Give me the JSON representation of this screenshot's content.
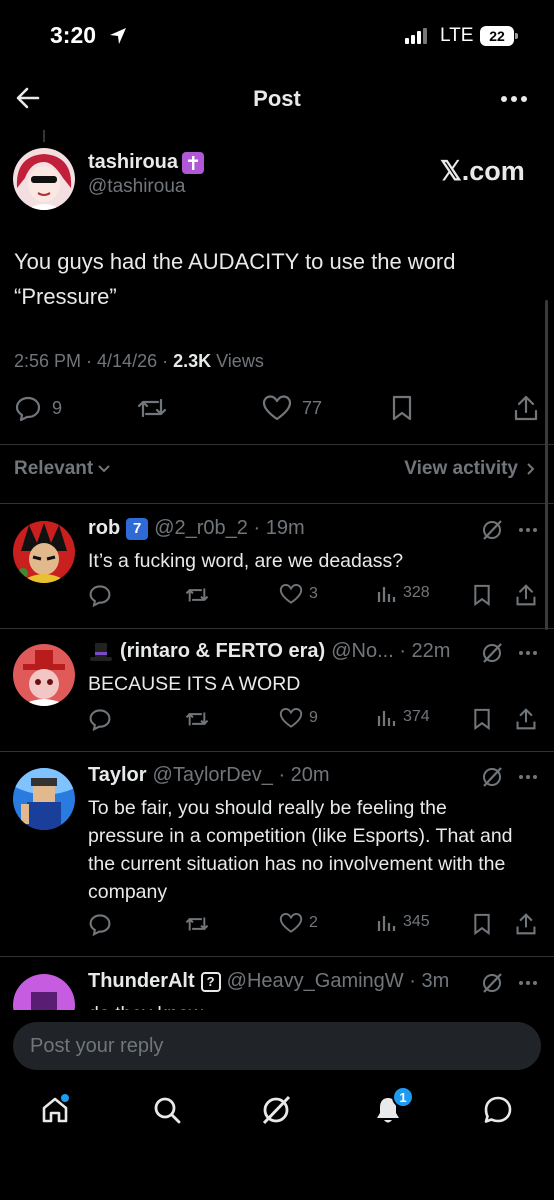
{
  "status_bar": {
    "time": "3:20",
    "network": "LTE",
    "battery": "22"
  },
  "header": {
    "title": "Post"
  },
  "post": {
    "author_name": "tashiroua",
    "author_handle": "@tashiroua",
    "source_label": "𝕏.com",
    "text": "You guys had the AUDACITY to use the word “Pressure”",
    "time": "2:56 PM · 4/14/26 · ",
    "views_count": "2.3K",
    "views_label": " Views",
    "replies": "9",
    "likes": "77"
  },
  "filter": {
    "sort_label": "Relevant",
    "activity_label": "View activity"
  },
  "replies": [
    {
      "name": "rob",
      "badge": "7",
      "handle_time": "@2_r0b_2 · 19m",
      "text": "It’s a fucking word, are we deadass?",
      "likes": "3",
      "views": "328"
    },
    {
      "name": "(rintaro & FERTO era)",
      "handle_time": "@No... · 22m",
      "text": "BECAUSE ITS A WORD",
      "likes": "9",
      "views": "374"
    },
    {
      "name": "Taylor",
      "handle_time": "@TaylorDev_ · 20m",
      "text": "To be fair, you should really be feeling the pressure in a competition (like Esports). That and the current situation has no involvement with the company",
      "likes": "2",
      "views": "345"
    },
    {
      "name": "ThunderAlt",
      "badge": "?",
      "handle_time": "@Heavy_GamingW · 3m",
      "text": "do they know"
    }
  ],
  "reply_input": {
    "placeholder": "Post your reply"
  },
  "tabbar": {
    "notification_count": "1"
  },
  "colors": {
    "accent": "#1d9bf0",
    "background": "#000000",
    "muted": "#71767b",
    "divider": "#2f3336"
  },
  "icons": [
    "location-arrow-icon",
    "back-arrow-icon",
    "more-icon",
    "reply-icon",
    "repost-icon",
    "like-icon",
    "bookmark-icon",
    "share-icon",
    "views-icon",
    "grok-icon",
    "home-icon",
    "search-icon",
    "notifications-icon",
    "messages-icon"
  ]
}
